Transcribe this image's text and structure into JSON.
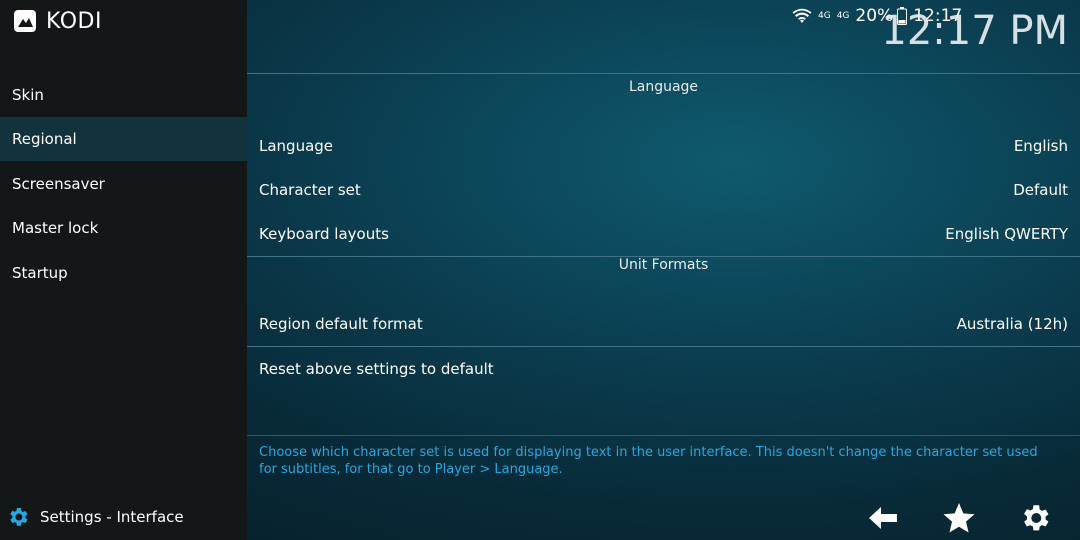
{
  "app": {
    "logo_text": "KODI"
  },
  "status_bar": {
    "network": "4G",
    "signal": "4G",
    "battery": "20%",
    "time": "12:17"
  },
  "clock": "12:17 PM",
  "sidebar": {
    "items": [
      {
        "label": "Skin"
      },
      {
        "label": "Regional"
      },
      {
        "label": "Screensaver"
      },
      {
        "label": "Master lock"
      },
      {
        "label": "Startup"
      }
    ],
    "active_index": 1
  },
  "sections": {
    "language": {
      "header": "Language",
      "rows": [
        {
          "label": "Language",
          "value": "English"
        },
        {
          "label": "Character set",
          "value": "Default"
        },
        {
          "label": "Keyboard layouts",
          "value": "English QWERTY"
        }
      ]
    },
    "unit_formats": {
      "header": "Unit Formats",
      "rows": [
        {
          "label": "Region default format",
          "value": "Australia (12h)"
        }
      ]
    },
    "reset": {
      "label": "Reset above settings to default"
    }
  },
  "help_text": "Choose which character set is used for displaying text in the user interface. This doesn't change the character set used for subtitles, for that go to Player > Language.",
  "footer": {
    "title": "Settings - Interface"
  },
  "icons": [
    "kodi-logo-icon",
    "wifi-icon",
    "battery-icon",
    "gear-icon",
    "back-arrow-icon",
    "star-icon",
    "settings-gear-icon"
  ],
  "colors": {
    "accent_help": "#28a8e0",
    "sidebar_active": "#12323d",
    "sidebar_bg": "#141718"
  }
}
